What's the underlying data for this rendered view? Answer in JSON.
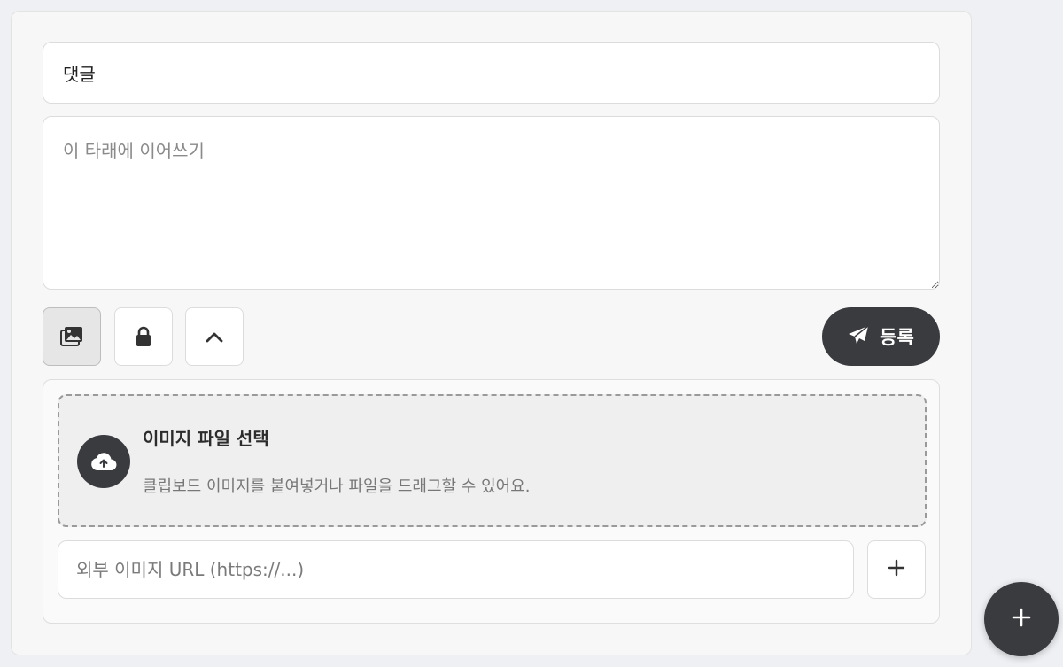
{
  "form": {
    "title_value": "댓글",
    "body_placeholder": "이 타래에 이어쓰기"
  },
  "toolbar": {
    "image_toggle_icon": "image-gallery-icon",
    "lock_icon": "lock-icon",
    "collapse_icon": "chevron-up-icon",
    "submit_label": "등록",
    "submit_icon": "paper-plane-icon"
  },
  "upload": {
    "title": "이미지 파일 선택",
    "description": "클립보드 이미지를 붙여넣거나 파일을 드래그할 수 있어요.",
    "icon": "cloud-upload-icon",
    "url_placeholder": "외부 이미지 URL (https://...)",
    "url_add_icon": "plus-icon"
  },
  "fab": {
    "icon": "plus-icon"
  },
  "colors": {
    "accent_dark": "#3a3b3f",
    "page_background": "#eef0f3",
    "card_background": "#f7f7f7"
  }
}
